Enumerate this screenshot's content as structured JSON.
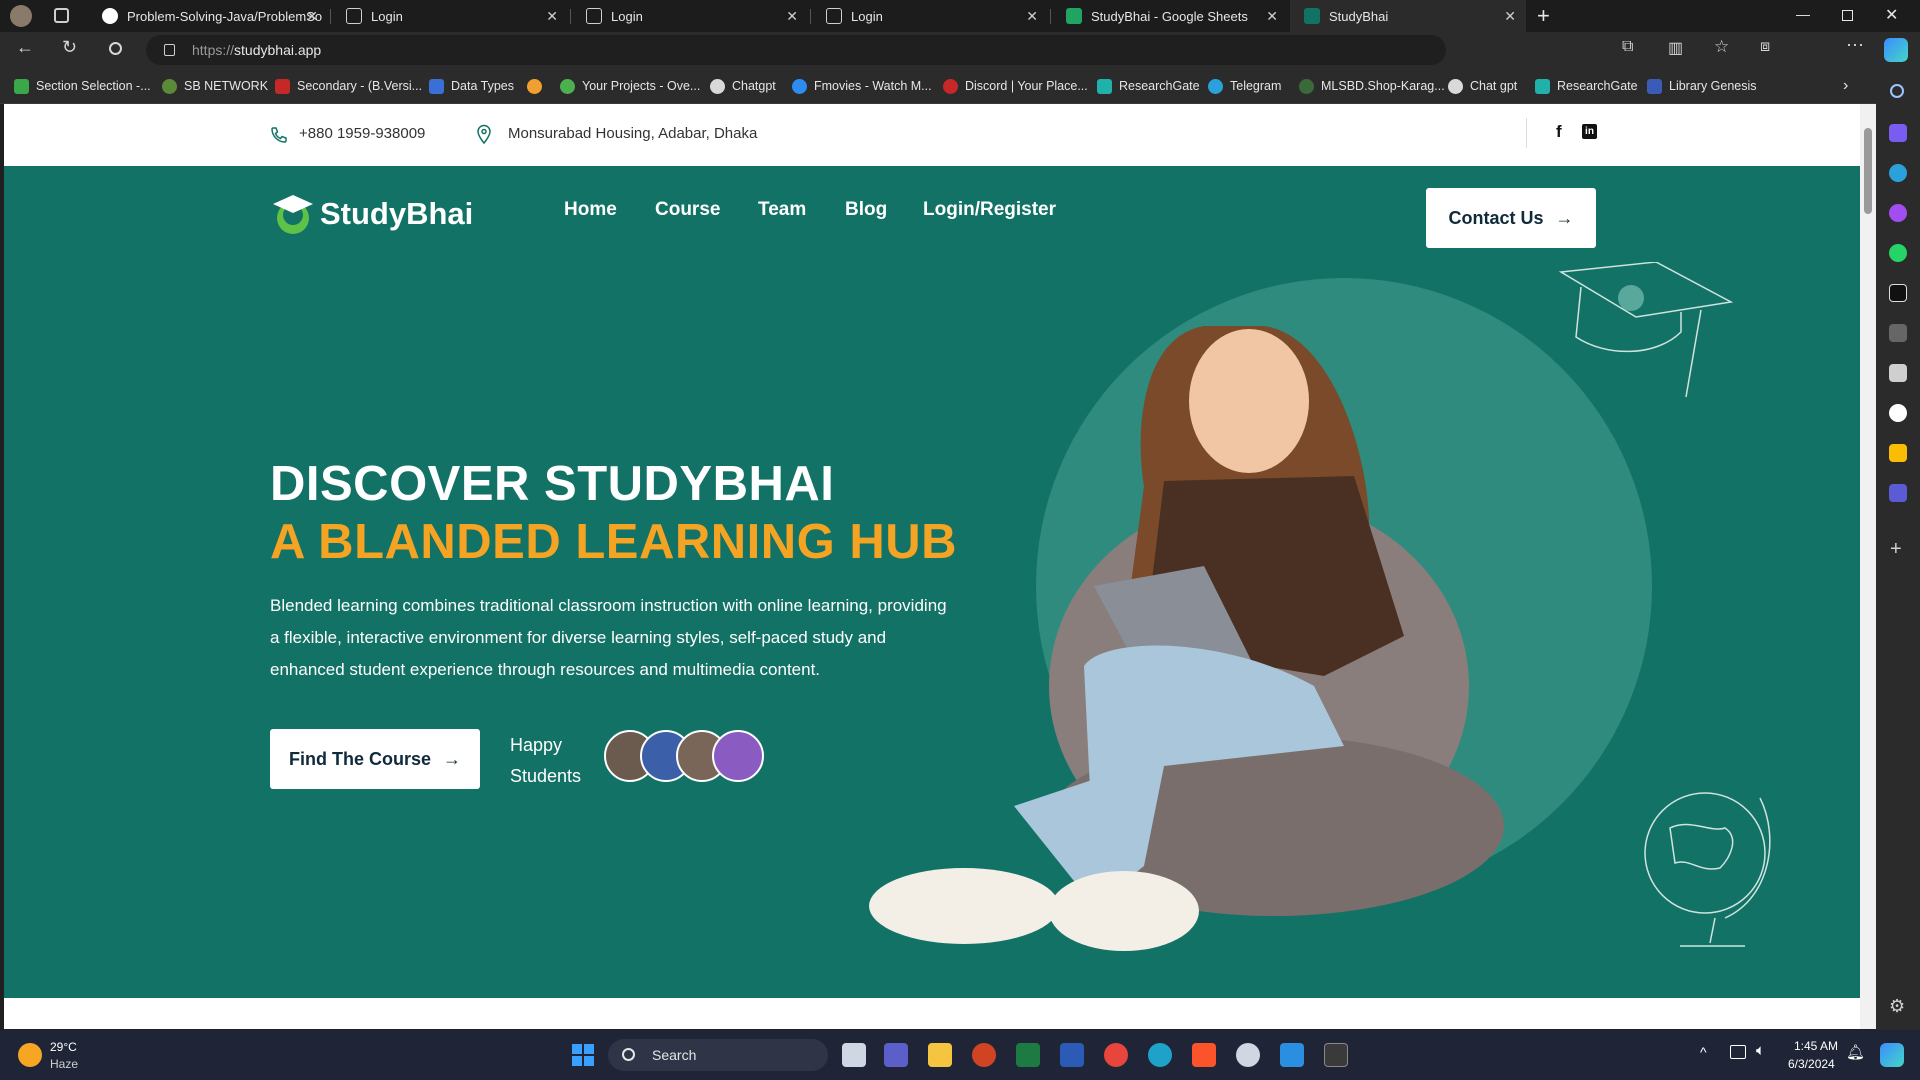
{
  "browser": {
    "tabs": [
      {
        "title": "Problem-Solving-Java/ProblemSo"
      },
      {
        "title": "Login"
      },
      {
        "title": "Login"
      },
      {
        "title": "Login"
      },
      {
        "title": "StudyBhai - Google Sheets"
      },
      {
        "title": "StudyBhai"
      }
    ],
    "url_prefix": "https://",
    "url_host": "studybhai.app",
    "bookmarks": [
      "Section Selection -...",
      "SB NETWORK",
      "Secondary - (B.Versi...",
      "Data Types",
      "Your Projects - Ove...",
      "Chatgpt",
      "Fmovies - Watch M...",
      "Discord | Your Place...",
      "ResearchGate",
      "Telegram",
      "MLSBD.Shop-Karag...",
      "Chat gpt",
      "ResearchGate",
      "Library Genesis"
    ]
  },
  "topbar": {
    "phone": "+880 1959-938009",
    "address": "Monsurabad Housing, Adabar, Dhaka"
  },
  "nav": {
    "logo": "StudyBhai",
    "links": [
      "Home",
      "Course",
      "Team",
      "Blog",
      "Login/Register"
    ],
    "contact": "Contact Us"
  },
  "hero": {
    "title_line1": "DISCOVER STUDYBHAI",
    "title_line2": "A BLANDED LEARNING HUB",
    "description": "Blended learning combines traditional classroom instruction with online learning, providing a flexible, interactive environment for diverse learning styles, self-paced study and enhanced student experience through resources and multimedia content.",
    "cta": "Find The Course",
    "happy_line1": "Happy",
    "happy_line2": "Students"
  },
  "taskbar": {
    "weather_temp": "29°C",
    "weather_desc": "Haze",
    "search": "Search",
    "time": "1:45 AM",
    "date": "6/3/2024"
  },
  "colors": {
    "hero_bg": "#137266",
    "accent": "#f4a323",
    "logo_green": "#5dc246"
  }
}
